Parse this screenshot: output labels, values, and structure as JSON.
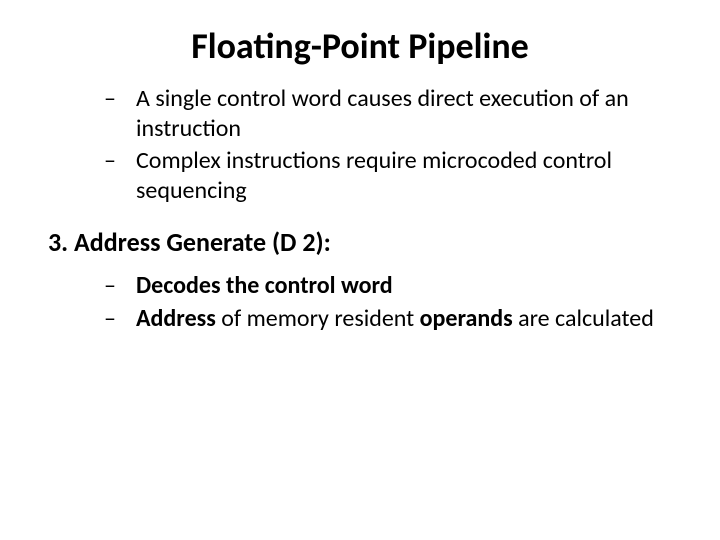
{
  "title": "Floating-Point Pipeline",
  "bullets_top": [
    "A single control word causes direct execution of an instruction",
    "Complex instructions require microcoded control sequencing"
  ],
  "section_number": "3.",
  "section_label": "Address Generate (D 2):",
  "bullets_bottom": {
    "b0_bold": "Decodes the control word",
    "b1_boldA": "Address",
    "b1_mid": " of memory resident ",
    "b1_boldB": "operands",
    "b1_tail": " are calculated"
  }
}
